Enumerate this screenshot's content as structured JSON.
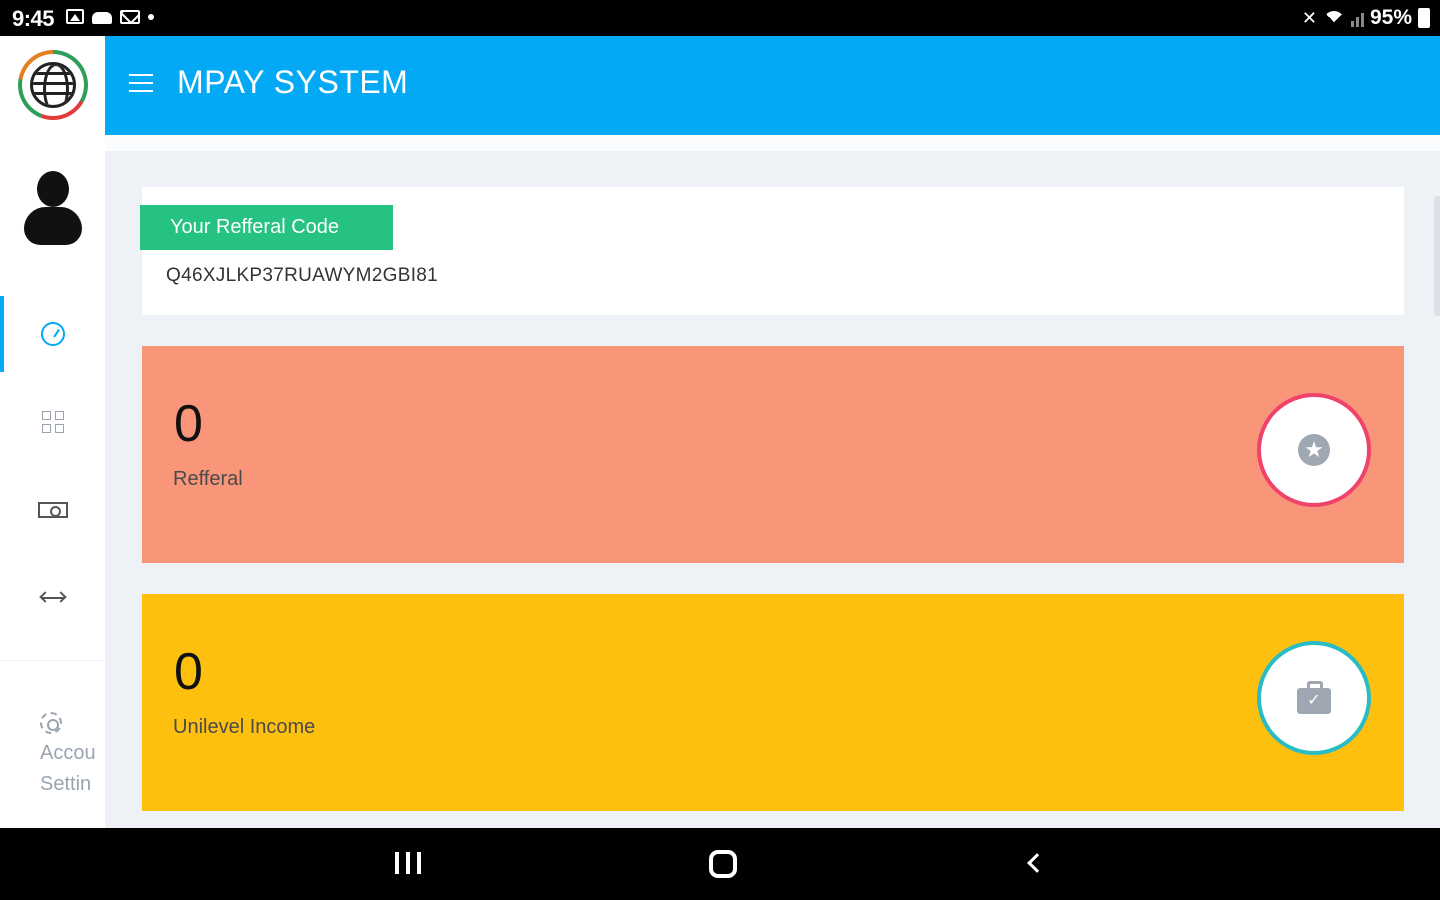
{
  "status_bar": {
    "time": "9:45",
    "battery": "95%",
    "icons_left": [
      "image-icon",
      "cloud-icon",
      "mail-icon",
      "dot-icon"
    ],
    "icons_right": [
      "mute-icon",
      "wifi-icon",
      "signal-icon",
      "battery-icon"
    ]
  },
  "header": {
    "title": "MPAY SYSTEM",
    "accent_color": "#03a9f4"
  },
  "sidebar": {
    "items": [
      {
        "icon": "dashboard-icon",
        "active": true
      },
      {
        "icon": "grid-icon",
        "active": false
      },
      {
        "icon": "money-icon",
        "active": false
      },
      {
        "icon": "transfer-icon",
        "active": false
      }
    ],
    "settings_line1": "Accou",
    "settings_line2": "Settin"
  },
  "referral": {
    "badge_label": "Your Refferal Code",
    "code": "Q46XJLKP37RUAWYM2GBI81",
    "badge_color": "#26c281"
  },
  "stats": [
    {
      "value": "0",
      "label": "Refferal",
      "color": "#f9967a",
      "ring_color": "#f0436a",
      "icon": "star-icon"
    },
    {
      "value": "0",
      "label": "Unilevel Income",
      "color": "#fec00f",
      "ring_color": "#29bcc4",
      "icon": "briefcase-icon"
    }
  ]
}
